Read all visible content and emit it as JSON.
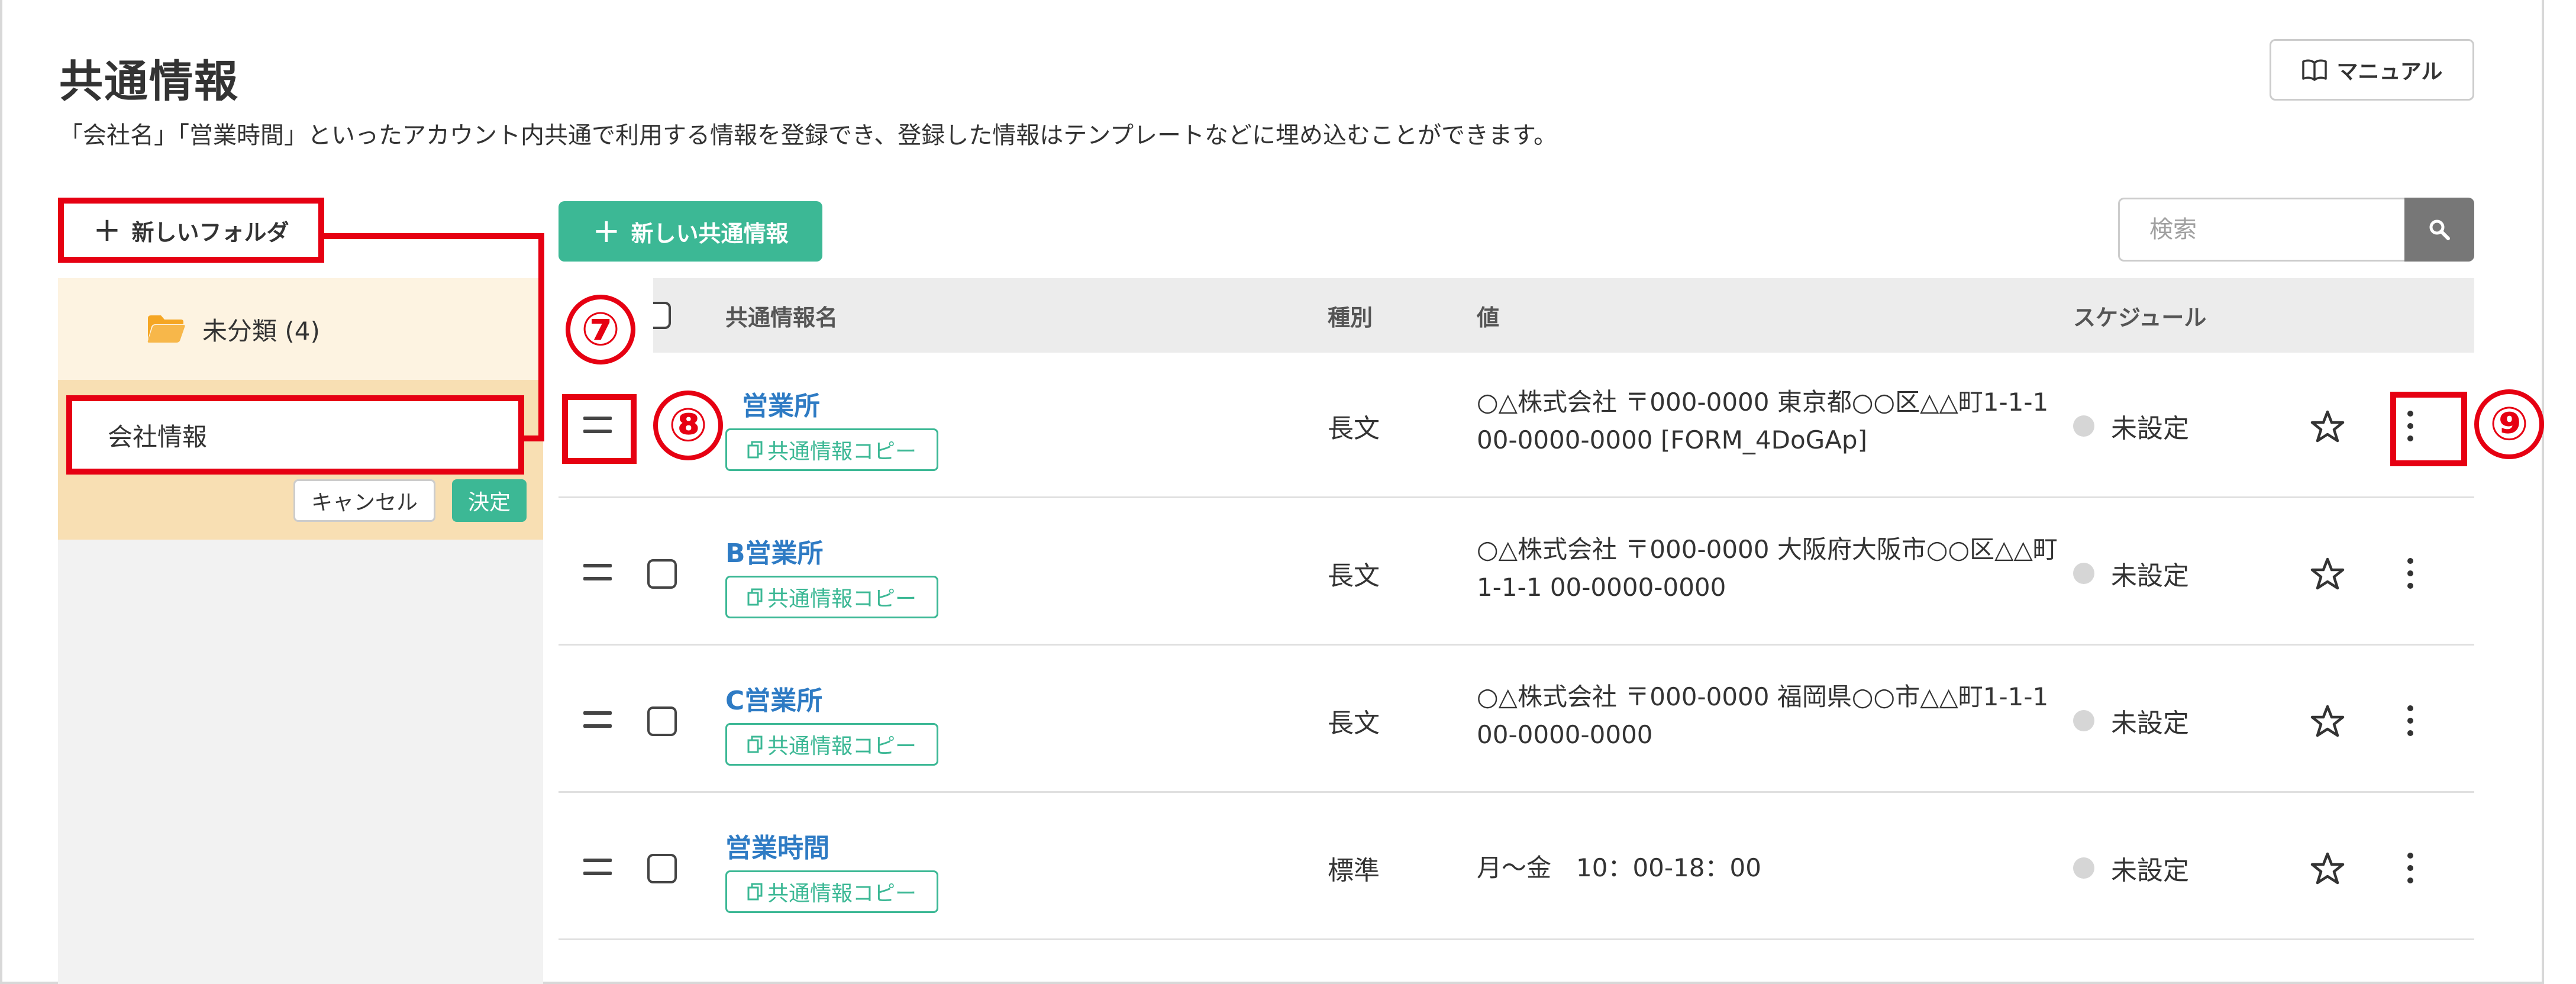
{
  "header": {
    "title": "共通情報",
    "description": "「会社名」「営業時間」といったアカウント内共通で利用する情報を登録でき、登録した情報はテンプレートなどに埋め込むことができます。",
    "manual_label": "マニュアル"
  },
  "sidebar": {
    "new_folder_label": "新しいフォルダ",
    "folder_label": "未分類 (4)",
    "new_folder_input_value": "会社情報",
    "cancel_label": "キャンセル",
    "decide_label": "決定"
  },
  "toolbar": {
    "new_common_label": "新しい共通情報",
    "search_placeholder": "検索"
  },
  "table": {
    "columns": {
      "name": "共通情報名",
      "kind": "種別",
      "value": "値",
      "schedule": "スケジュール"
    },
    "rows": [
      {
        "name": "営業所",
        "copy_label": "共通情報コピー",
        "kind": "長文",
        "value": "○△株式会社 〒000-0000 東京都○○区△△町1-1-1 00-0000-0000 [FORM_4DoGAp]",
        "schedule": "未設定"
      },
      {
        "name": "B営業所",
        "copy_label": "共通情報コピー",
        "kind": "長文",
        "value": "○△株式会社 〒000-0000 大阪府大阪市○○区△△町1-1-1 00-0000-0000",
        "schedule": "未設定"
      },
      {
        "name": "C営業所",
        "copy_label": "共通情報コピー",
        "kind": "長文",
        "value": "○△株式会社 〒000-0000 福岡県○○市△△町1-1-1 00-0000-0000",
        "schedule": "未設定"
      },
      {
        "name": "営業時間",
        "copy_label": "共通情報コピー",
        "kind": "標準",
        "value": "月～金　10：00-18：00",
        "schedule": "未設定"
      }
    ]
  },
  "annotations": {
    "marker_7": "⑦",
    "marker_8": "⑧",
    "marker_9": "⑨"
  },
  "colors": {
    "accent_green": "#3cb895",
    "link_blue": "#2e7bc4",
    "annotation_red": "#e60012",
    "folder_orange": "#f5a623"
  }
}
